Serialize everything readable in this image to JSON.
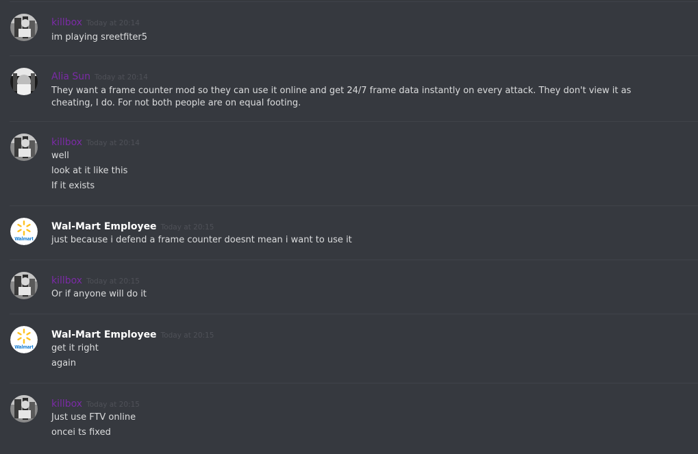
{
  "messages": [
    {
      "author": "killbox",
      "timestamp": "Today at 20:14",
      "lines": [
        "im playing sreetfiter5"
      ]
    },
    {
      "author": "Alia Sun",
      "timestamp": "Today at 20:14",
      "lines": [
        "They want a frame counter mod so they can use it online and get 24/7 frame data instantly on every attack. They don't view it as cheating, I do. For not both people are on equal footing."
      ]
    },
    {
      "author": "killbox",
      "timestamp": "Today at 20:14",
      "lines": [
        "well",
        "look at it like this",
        "If it exists"
      ]
    },
    {
      "author": "Wal-Mart Employee",
      "timestamp": "Today at 20:15",
      "lines": [
        "just because i defend a frame counter doesnt mean i want to use it"
      ]
    },
    {
      "author": "killbox",
      "timestamp": "Today at 20:15",
      "lines": [
        "Or if anyone will do it"
      ]
    },
    {
      "author": "Wal-Mart Employee",
      "timestamp": "Today at 20:15",
      "lines": [
        "get it right",
        "again"
      ]
    },
    {
      "author": "killbox",
      "timestamp": "Today at 20:15",
      "lines": [
        "Just use FTV online",
        "oncei ts fixed"
      ]
    }
  ],
  "avatar_logo_text": "Walmart",
  "colors": {
    "background": "#36393f",
    "killbox_name": "#7b2ba6",
    "alia_name": "#7b2ba6",
    "walmart_name": "#ffffff",
    "timestamp": "#4f5158",
    "text": "#dcddde",
    "walmart_spark": "#ffc220",
    "walmart_blue": "#0071ce"
  }
}
